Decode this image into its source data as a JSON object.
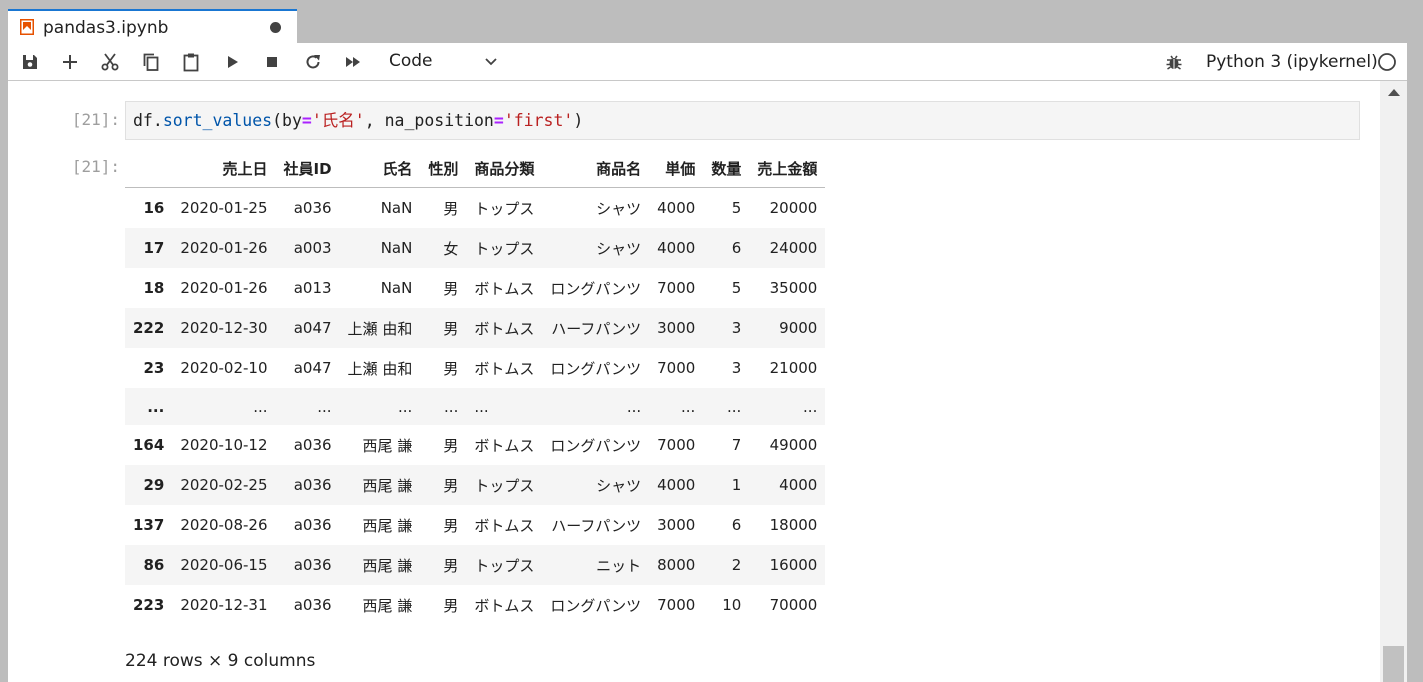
{
  "tab": {
    "title": "pandas3.ipynb",
    "modified": true
  },
  "toolbar": {
    "cell_type": "Code",
    "kernel_name": "Python 3 (ipykernel)",
    "icons": [
      "save-icon",
      "add-icon",
      "cut-icon",
      "copy-icon",
      "paste-icon",
      "run-icon",
      "stop-icon",
      "restart-icon",
      "run-all-icon"
    ]
  },
  "cell": {
    "input_prompt": "[21]:",
    "output_prompt": "[21]:",
    "code": {
      "obj": "df",
      "dot": ".",
      "method": "sort_values",
      "open": "(",
      "arg1": "by",
      "eq1": "=",
      "val1": "'氏名'",
      "sep": ", ",
      "arg2": "na_position",
      "eq2": "=",
      "val2": "'first'",
      "close": ")"
    }
  },
  "table": {
    "columns": [
      "売上日",
      "社員ID",
      "氏名",
      "性別",
      "商品分類",
      "商品名",
      "単価",
      "数量",
      "売上金額"
    ],
    "rows": [
      [
        "16",
        "2020-01-25",
        "a036",
        "NaN",
        "男",
        "トップス",
        "シャツ",
        "4000",
        "5",
        "20000"
      ],
      [
        "17",
        "2020-01-26",
        "a003",
        "NaN",
        "女",
        "トップス",
        "シャツ",
        "4000",
        "6",
        "24000"
      ],
      [
        "18",
        "2020-01-26",
        "a013",
        "NaN",
        "男",
        "ボトムス",
        "ロングパンツ",
        "7000",
        "5",
        "35000"
      ],
      [
        "222",
        "2020-12-30",
        "a047",
        "上瀬 由和",
        "男",
        "ボトムス",
        "ハーフパンツ",
        "3000",
        "3",
        "9000"
      ],
      [
        "23",
        "2020-02-10",
        "a047",
        "上瀬 由和",
        "男",
        "ボトムス",
        "ロングパンツ",
        "7000",
        "3",
        "21000"
      ],
      [
        "...",
        "...",
        "...",
        "...",
        "...",
        "...",
        "...",
        "...",
        "...",
        "..."
      ],
      [
        "164",
        "2020-10-12",
        "a036",
        "西尾 謙",
        "男",
        "ボトムス",
        "ロングパンツ",
        "7000",
        "7",
        "49000"
      ],
      [
        "29",
        "2020-02-25",
        "a036",
        "西尾 謙",
        "男",
        "トップス",
        "シャツ",
        "4000",
        "1",
        "4000"
      ],
      [
        "137",
        "2020-08-26",
        "a036",
        "西尾 謙",
        "男",
        "ボトムス",
        "ハーフパンツ",
        "3000",
        "6",
        "18000"
      ],
      [
        "86",
        "2020-06-15",
        "a036",
        "西尾 謙",
        "男",
        "トップス",
        "ニット",
        "8000",
        "2",
        "16000"
      ],
      [
        "223",
        "2020-12-31",
        "a036",
        "西尾 謙",
        "男",
        "ボトムス",
        "ロングパンツ",
        "7000",
        "10",
        "70000"
      ]
    ],
    "shape": "224 rows × 9 columns"
  },
  "colors": {
    "tab_accent": "#1976d2",
    "code_bg": "#f5f5f5",
    "string": "#ba2121",
    "attr": "#0055aa",
    "operator": "#aa22ff"
  }
}
